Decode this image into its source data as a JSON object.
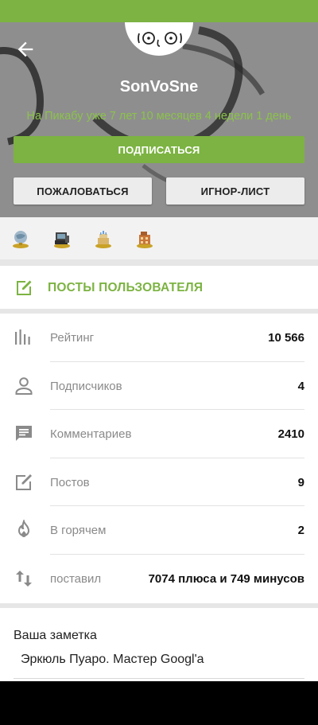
{
  "profile": {
    "username": "SonVoSne",
    "since": "На Пикабу уже 7 лет 10 месяцев 4 недели 1 день"
  },
  "actions": {
    "subscribe": "ПОДПИСАТЬСЯ",
    "report": "ПОЖАЛОВАТЬСЯ",
    "ignore": "ИГНОР-ЛИСТ"
  },
  "awards": [
    "award-globe-icon",
    "award-computer-icon",
    "award-cake-icon",
    "award-building-icon"
  ],
  "posts_link": {
    "label": "ПОСТЫ ПОЛЬЗОВАТЕЛЯ",
    "icon": "edit-icon"
  },
  "stats": [
    {
      "label": "Рейтинг",
      "value": "10 566",
      "icon": "rating-bars-icon"
    },
    {
      "label": "Подписчиков",
      "value": "4",
      "icon": "person-icon"
    },
    {
      "label": "Комментариев",
      "value": "2410",
      "icon": "comment-icon"
    },
    {
      "label": "Постов",
      "value": "9",
      "icon": "edit-icon"
    },
    {
      "label": "В горячем",
      "value": "2",
      "icon": "flame-icon"
    },
    {
      "label": "поставил",
      "value": "7074 плюса и 749 минусов",
      "icon": "swap-vertical-icon"
    }
  ],
  "note": {
    "title": "Ваша заметка",
    "text": "Эркюль Пуаро. Мастер Googl'a"
  },
  "colors": {
    "accent": "#7cb342",
    "accent_text": "#8bc34a",
    "header_bg": "#8f8f8f"
  }
}
